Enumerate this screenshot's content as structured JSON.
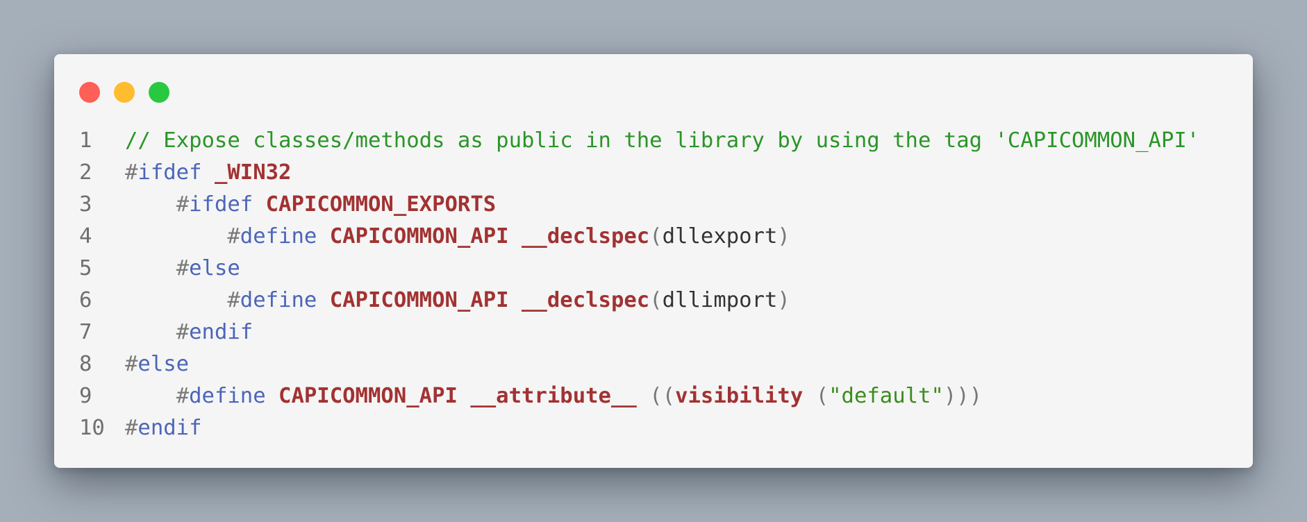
{
  "window": {
    "controls": [
      {
        "name": "close",
        "color": "#fe5f57"
      },
      {
        "name": "minimize",
        "color": "#febc2e"
      },
      {
        "name": "maximize",
        "color": "#28c840"
      }
    ]
  },
  "code": {
    "lines": [
      {
        "number": "1",
        "indent": "",
        "tokens": [
          {
            "type": "comment",
            "text": "// Expose classes/methods as public in the library by using the tag 'CAPICOMMON_API'"
          }
        ]
      },
      {
        "number": "2",
        "indent": "",
        "tokens": [
          {
            "type": "hash",
            "text": "#"
          },
          {
            "type": "directive",
            "text": "ifdef"
          },
          {
            "type": "plain",
            "text": " "
          },
          {
            "type": "macro",
            "text": "_WIN32"
          }
        ]
      },
      {
        "number": "3",
        "indent": "    ",
        "tokens": [
          {
            "type": "hash",
            "text": "#"
          },
          {
            "type": "directive",
            "text": "ifdef"
          },
          {
            "type": "plain",
            "text": " "
          },
          {
            "type": "macro",
            "text": "CAPICOMMON_EXPORTS"
          }
        ]
      },
      {
        "number": "4",
        "indent": "        ",
        "tokens": [
          {
            "type": "hash",
            "text": "#"
          },
          {
            "type": "directive",
            "text": "define"
          },
          {
            "type": "plain",
            "text": " "
          },
          {
            "type": "macro",
            "text": "CAPICOMMON_API"
          },
          {
            "type": "plain",
            "text": " "
          },
          {
            "type": "macro",
            "text": "__declspec"
          },
          {
            "type": "punct",
            "text": "("
          },
          {
            "type": "plain",
            "text": "dllexport"
          },
          {
            "type": "punct",
            "text": ")"
          }
        ]
      },
      {
        "number": "5",
        "indent": "    ",
        "tokens": [
          {
            "type": "hash",
            "text": "#"
          },
          {
            "type": "directive",
            "text": "else"
          }
        ]
      },
      {
        "number": "6",
        "indent": "        ",
        "tokens": [
          {
            "type": "hash",
            "text": "#"
          },
          {
            "type": "directive",
            "text": "define"
          },
          {
            "type": "plain",
            "text": " "
          },
          {
            "type": "macro",
            "text": "CAPICOMMON_API"
          },
          {
            "type": "plain",
            "text": " "
          },
          {
            "type": "macro",
            "text": "__declspec"
          },
          {
            "type": "punct",
            "text": "("
          },
          {
            "type": "plain",
            "text": "dllimport"
          },
          {
            "type": "punct",
            "text": ")"
          }
        ]
      },
      {
        "number": "7",
        "indent": "    ",
        "tokens": [
          {
            "type": "hash",
            "text": "#"
          },
          {
            "type": "directive",
            "text": "endif"
          }
        ]
      },
      {
        "number": "8",
        "indent": "",
        "tokens": [
          {
            "type": "hash",
            "text": "#"
          },
          {
            "type": "directive",
            "text": "else"
          }
        ]
      },
      {
        "number": "9",
        "indent": "    ",
        "tokens": [
          {
            "type": "hash",
            "text": "#"
          },
          {
            "type": "directive",
            "text": "define"
          },
          {
            "type": "plain",
            "text": " "
          },
          {
            "type": "macro",
            "text": "CAPICOMMON_API"
          },
          {
            "type": "plain",
            "text": " "
          },
          {
            "type": "macro",
            "text": "__attribute__"
          },
          {
            "type": "plain",
            "text": " "
          },
          {
            "type": "punct",
            "text": "(("
          },
          {
            "type": "macro",
            "text": "visibility"
          },
          {
            "type": "plain",
            "text": " "
          },
          {
            "type": "punct",
            "text": "("
          },
          {
            "type": "string",
            "text": "\"default\""
          },
          {
            "type": "punct",
            "text": ")))"
          }
        ]
      },
      {
        "number": "10",
        "indent": "",
        "tokens": [
          {
            "type": "hash",
            "text": "#"
          },
          {
            "type": "directive",
            "text": "endif"
          }
        ]
      }
    ]
  }
}
